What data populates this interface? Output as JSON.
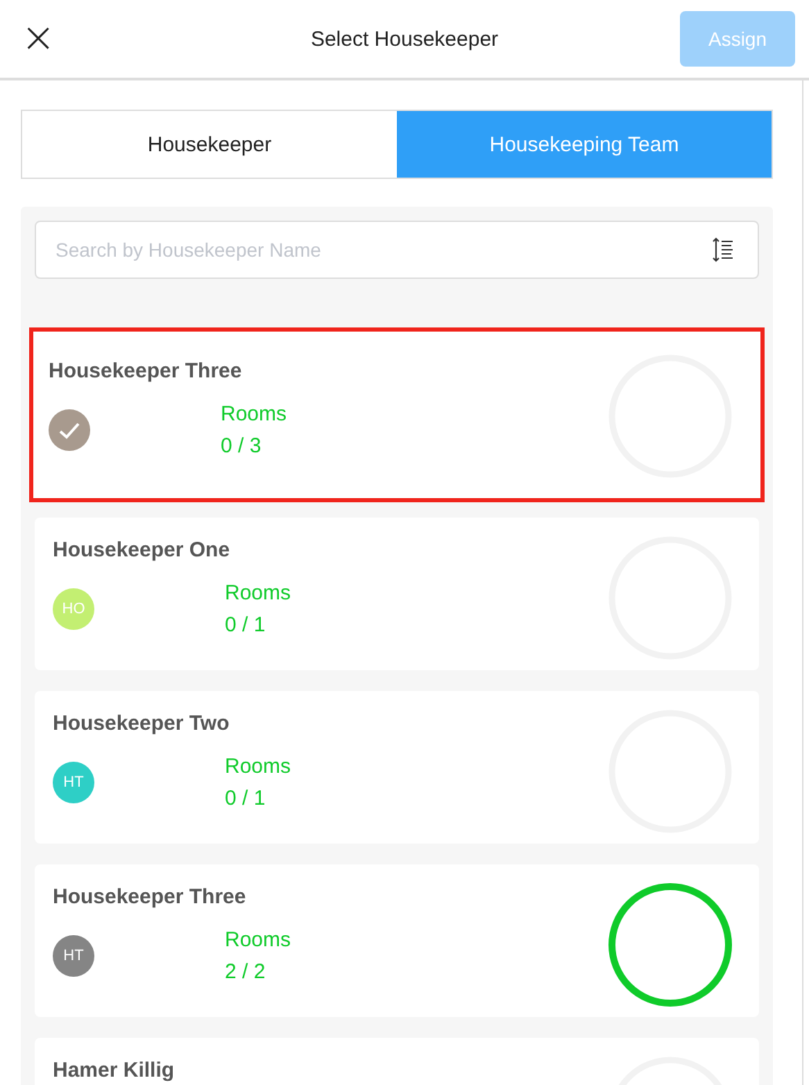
{
  "header": {
    "close": "×",
    "title": "Select Housekeeper",
    "assign": {
      "label": "Assign",
      "disabled": true
    }
  },
  "tabs": [
    {
      "label": "Housekeeper",
      "selected": false
    },
    {
      "label": "Housekeeping Team",
      "selected": true
    }
  ],
  "search": {
    "placeholder": "Search by Housekeeper Name"
  },
  "housekeepers": [
    {
      "name": "Housekeeper Three",
      "selected": true,
      "color": "#a89a8e",
      "rooms_label": "Rooms",
      "rooms": "0 / 3",
      "complete": false
    },
    {
      "name": "Housekeeper One",
      "selected": false,
      "color": "#c3ef72",
      "initials": "HO",
      "rooms_label": "Rooms",
      "rooms": "0 / 1",
      "complete": false
    },
    {
      "name": "Housekeeper Two",
      "selected": false,
      "color": "#2ecfc6",
      "initials": "HT",
      "rooms_label": "Rooms",
      "rooms": "0 / 1",
      "complete": false
    },
    {
      "name": "Housekeeper Three",
      "selected": false,
      "color": "#858585",
      "initials": "HT",
      "rooms_label": "Rooms",
      "rooms": "2 / 2",
      "complete": true
    },
    {
      "name": "Hamer Killig",
      "selected": false,
      "complete": false
    }
  ]
}
